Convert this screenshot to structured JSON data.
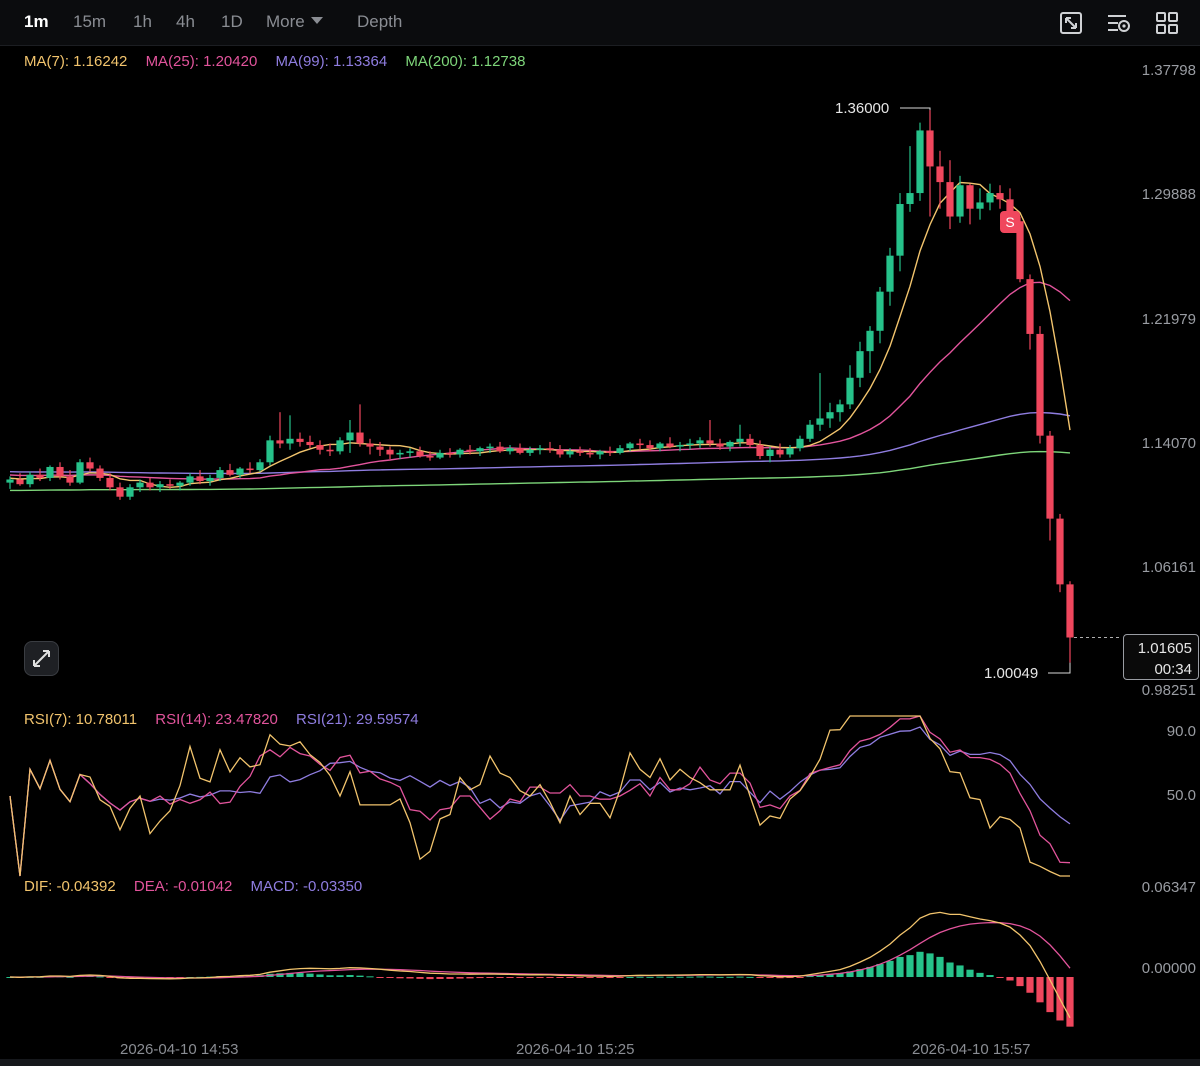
{
  "toolbar": {
    "timeframes": [
      "1m",
      "15m",
      "1h",
      "4h",
      "1D"
    ],
    "active": "1m",
    "more_label": "More",
    "depth_label": "Depth",
    "tools": [
      "chart-type-icon",
      "indicator-settings-icon",
      "layout-grid-icon"
    ]
  },
  "main": {
    "ma_legend": {
      "ma7": "MA(7): 1.16242",
      "ma25": "MA(25): 1.20420",
      "ma99": "MA(99): 1.13364",
      "ma200": "MA(200): 1.12738"
    },
    "price_axis": [
      "1.37798",
      "1.29888",
      "1.21979",
      "1.14070",
      "1.06161",
      "0.98251"
    ],
    "high_label": "1.36000",
    "low_label": "1.00049",
    "sell_marker": "S",
    "last_price": "1.01605",
    "countdown": "00:34"
  },
  "rsi": {
    "legend": {
      "rsi7": "RSI(7): 10.78011",
      "rsi14": "RSI(14): 23.47820",
      "rsi21": "RSI(21): 29.59574"
    },
    "axis": [
      "90.0",
      "50.0"
    ]
  },
  "macd": {
    "legend": {
      "dif": "DIF: -0.04392",
      "dea": "DEA: -0.01042",
      "macd": "MACD: -0.03350"
    },
    "axis": [
      "0.06347",
      "0.00000"
    ]
  },
  "time_axis": [
    "2026-04-10 14:53",
    "2026-04-10 15:25",
    "2026-04-10 15:57"
  ],
  "colors": {
    "up": "#26c28a",
    "down": "#f0475d",
    "ma7": "#f2c46d",
    "ma25": "#e2549c",
    "ma99": "#8f7de0",
    "ma200": "#7ed67a",
    "rsi7": "#f2c46d",
    "rsi14": "#e2549c",
    "rsi21": "#8f7de0"
  },
  "chart_data": {
    "type": "candlestick",
    "ylim": [
      0.98251,
      1.37798
    ],
    "candles_ohlc": [
      [
        1.115,
        1.119,
        1.111,
        1.117
      ],
      [
        1.117,
        1.121,
        1.113,
        1.114
      ],
      [
        1.114,
        1.122,
        1.112,
        1.12
      ],
      [
        1.12,
        1.124,
        1.116,
        1.118
      ],
      [
        1.118,
        1.126,
        1.116,
        1.125
      ],
      [
        1.125,
        1.128,
        1.117,
        1.119
      ],
      [
        1.119,
        1.123,
        1.113,
        1.115
      ],
      [
        1.115,
        1.13,
        1.114,
        1.128
      ],
      [
        1.128,
        1.131,
        1.122,
        1.124
      ],
      [
        1.124,
        1.126,
        1.116,
        1.118
      ],
      [
        1.118,
        1.121,
        1.11,
        1.112
      ],
      [
        1.112,
        1.115,
        1.104,
        1.106
      ],
      [
        1.106,
        1.114,
        1.104,
        1.112
      ],
      [
        1.112,
        1.117,
        1.109,
        1.115
      ],
      [
        1.115,
        1.118,
        1.11,
        1.112
      ],
      [
        1.112,
        1.116,
        1.109,
        1.114
      ],
      [
        1.114,
        1.117,
        1.111,
        1.113
      ],
      [
        1.113,
        1.116,
        1.11,
        1.115
      ],
      [
        1.115,
        1.121,
        1.113,
        1.119
      ],
      [
        1.119,
        1.123,
        1.114,
        1.116
      ],
      [
        1.116,
        1.12,
        1.113,
        1.118
      ],
      [
        1.118,
        1.125,
        1.116,
        1.123
      ],
      [
        1.123,
        1.127,
        1.119,
        1.12
      ],
      [
        1.12,
        1.125,
        1.118,
        1.124
      ],
      [
        1.124,
        1.128,
        1.121,
        1.123
      ],
      [
        1.123,
        1.13,
        1.122,
        1.128
      ],
      [
        1.128,
        1.145,
        1.126,
        1.142
      ],
      [
        1.142,
        1.16,
        1.137,
        1.14
      ],
      [
        1.14,
        1.158,
        1.136,
        1.143
      ],
      [
        1.143,
        1.147,
        1.138,
        1.141
      ],
      [
        1.141,
        1.145,
        1.137,
        1.139
      ],
      [
        1.139,
        1.142,
        1.133,
        1.136
      ],
      [
        1.136,
        1.14,
        1.132,
        1.135
      ],
      [
        1.135,
        1.144,
        1.133,
        1.142
      ],
      [
        1.142,
        1.155,
        1.134,
        1.147
      ],
      [
        1.147,
        1.165,
        1.138,
        1.14
      ],
      [
        1.14,
        1.143,
        1.133,
        1.138
      ],
      [
        1.138,
        1.141,
        1.132,
        1.136
      ],
      [
        1.136,
        1.138,
        1.13,
        1.133
      ],
      [
        1.133,
        1.136,
        1.13,
        1.134
      ],
      [
        1.134,
        1.137,
        1.131,
        1.135
      ],
      [
        1.135,
        1.138,
        1.131,
        1.132
      ],
      [
        1.132,
        1.135,
        1.129,
        1.131
      ],
      [
        1.131,
        1.136,
        1.13,
        1.134
      ],
      [
        1.134,
        1.137,
        1.131,
        1.133
      ],
      [
        1.133,
        1.137,
        1.131,
        1.136
      ],
      [
        1.136,
        1.139,
        1.133,
        1.135
      ],
      [
        1.135,
        1.138,
        1.132,
        1.137
      ],
      [
        1.137,
        1.14,
        1.134,
        1.138
      ],
      [
        1.138,
        1.141,
        1.134,
        1.135
      ],
      [
        1.135,
        1.139,
        1.133,
        1.137
      ],
      [
        1.137,
        1.14,
        1.133,
        1.134
      ],
      [
        1.134,
        1.138,
        1.132,
        1.136
      ],
      [
        1.136,
        1.139,
        1.133,
        1.137
      ],
      [
        1.137,
        1.141,
        1.134,
        1.136
      ],
      [
        1.136,
        1.139,
        1.131,
        1.133
      ],
      [
        1.133,
        1.137,
        1.131,
        1.135
      ],
      [
        1.135,
        1.138,
        1.132,
        1.134
      ],
      [
        1.134,
        1.137,
        1.131,
        1.133
      ],
      [
        1.133,
        1.136,
        1.13,
        1.135
      ],
      [
        1.135,
        1.138,
        1.132,
        1.134
      ],
      [
        1.134,
        1.139,
        1.133,
        1.137
      ],
      [
        1.137,
        1.141,
        1.135,
        1.14
      ],
      [
        1.14,
        1.143,
        1.136,
        1.139
      ],
      [
        1.139,
        1.142,
        1.135,
        1.137
      ],
      [
        1.137,
        1.141,
        1.135,
        1.14
      ],
      [
        1.14,
        1.144,
        1.137,
        1.138
      ],
      [
        1.138,
        1.141,
        1.135,
        1.139
      ],
      [
        1.139,
        1.143,
        1.136,
        1.14
      ],
      [
        1.14,
        1.144,
        1.137,
        1.142
      ],
      [
        1.142,
        1.155,
        1.138,
        1.14
      ],
      [
        1.14,
        1.143,
        1.136,
        1.138
      ],
      [
        1.138,
        1.142,
        1.135,
        1.141
      ],
      [
        1.141,
        1.152,
        1.138,
        1.143
      ],
      [
        1.143,
        1.146,
        1.137,
        1.139
      ],
      [
        1.139,
        1.142,
        1.13,
        1.132
      ],
      [
        1.132,
        1.138,
        1.128,
        1.136
      ],
      [
        1.136,
        1.14,
        1.131,
        1.133
      ],
      [
        1.133,
        1.139,
        1.131,
        1.137
      ],
      [
        1.137,
        1.145,
        1.135,
        1.143
      ],
      [
        1.143,
        1.155,
        1.141,
        1.152
      ],
      [
        1.152,
        1.185,
        1.148,
        1.156
      ],
      [
        1.156,
        1.166,
        1.15,
        1.16
      ],
      [
        1.16,
        1.168,
        1.154,
        1.165
      ],
      [
        1.165,
        1.19,
        1.162,
        1.182
      ],
      [
        1.182,
        1.205,
        1.176,
        1.199
      ],
      [
        1.199,
        1.215,
        1.185,
        1.212
      ],
      [
        1.212,
        1.24,
        1.204,
        1.237
      ],
      [
        1.237,
        1.265,
        1.228,
        1.26
      ],
      [
        1.26,
        1.3,
        1.25,
        1.293
      ],
      [
        1.293,
        1.33,
        1.288,
        1.3
      ],
      [
        1.3,
        1.345,
        1.295,
        1.34
      ],
      [
        1.34,
        1.353,
        1.285,
        1.317
      ],
      [
        1.317,
        1.327,
        1.29,
        1.307
      ],
      [
        1.307,
        1.321,
        1.277,
        1.285
      ],
      [
        1.285,
        1.311,
        1.281,
        1.305
      ],
      [
        1.305,
        1.306,
        1.28,
        1.29
      ],
      [
        1.29,
        1.303,
        1.283,
        1.294
      ],
      [
        1.294,
        1.306,
        1.289,
        1.3
      ],
      [
        1.3,
        1.305,
        1.29,
        1.296
      ],
      [
        1.296,
        1.303,
        1.278,
        1.282
      ],
      [
        1.282,
        1.285,
        1.243,
        1.245
      ],
      [
        1.245,
        1.248,
        1.2,
        1.21
      ],
      [
        1.21,
        1.215,
        1.14,
        1.145
      ],
      [
        1.145,
        1.148,
        1.078,
        1.092
      ],
      [
        1.092,
        1.095,
        1.045,
        1.05
      ],
      [
        1.05,
        1.052,
        1.0,
        1.01605
      ]
    ]
  }
}
